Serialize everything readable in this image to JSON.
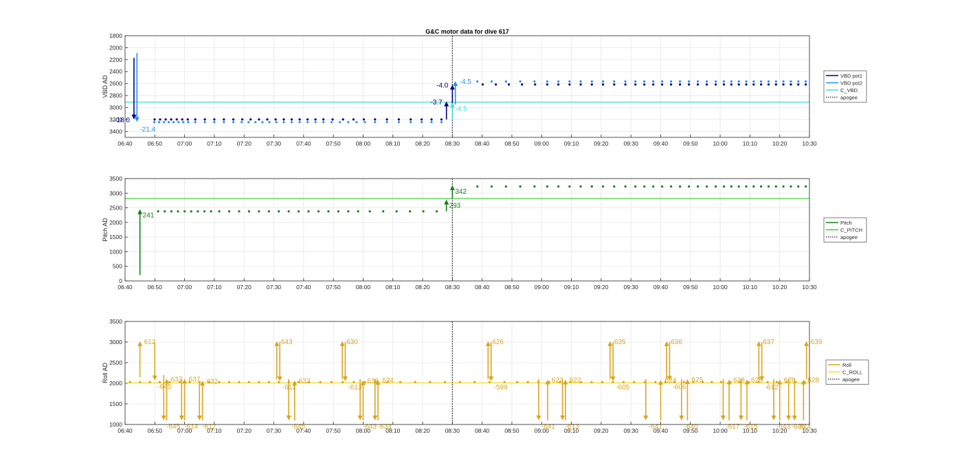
{
  "chart_data": {
    "title": "G&C motor data for dive 617",
    "time_ticks": [
      "06:40",
      "06:50",
      "07:00",
      "07:10",
      "07:20",
      "07:30",
      "07:40",
      "07:50",
      "08:00",
      "08:10",
      "08:20",
      "08:30",
      "08:40",
      "08:50",
      "09:00",
      "09:10",
      "09:20",
      "09:30",
      "09:40",
      "09:50",
      "10:00",
      "10:10",
      "10:20",
      "10:30"
    ],
    "apogee_time": "08:30",
    "panels": [
      {
        "type": "scatter",
        "ylabel": "VBD AD",
        "ylim": [
          1800,
          3500
        ],
        "y_reversed": true,
        "yticks": [
          1800,
          2000,
          2200,
          2400,
          2600,
          2800,
          3000,
          3200,
          3400
        ],
        "hlines": [
          {
            "series": "C_VBD",
            "y": 2910
          }
        ],
        "legend": [
          {
            "label": "VBD pot1",
            "color": "#000080",
            "style": "solid"
          },
          {
            "label": "VBD pot2",
            "color": "#1e90ff",
            "style": "solid"
          },
          {
            "label": "C_VBD",
            "color": "#40e0d0",
            "style": "solid"
          },
          {
            "label": "apogee",
            "color": "#444444",
            "style": "dotted"
          }
        ],
        "point_sets": [
          {
            "series": "VBD pot1",
            "color": "#000080",
            "y": 3200,
            "x_min": [
              "06:49",
              "07:02",
              "07:18",
              "07:32",
              "07:48",
              "08:02",
              "08:18"
            ],
            "x_max": [
              "07:02",
              "07:18",
              "07:32",
              "07:48",
              "08:02",
              "08:18",
              "08:28"
            ],
            "count": [
              7,
              5,
              5,
              6,
              4,
              4,
              3
            ]
          },
          {
            "series": "VBD pot2",
            "color": "#1e90ff",
            "y": 3245,
            "x_min": [
              "06:49",
              "07:02",
              "07:18",
              "07:32",
              "07:48",
              "08:02",
              "08:18"
            ],
            "x_max": [
              "07:02",
              "07:18",
              "07:32",
              "07:48",
              "08:02",
              "08:18",
              "08:28"
            ],
            "count": [
              8,
              5,
              6,
              6,
              5,
              4,
              3
            ]
          },
          {
            "series": "VBD pot1",
            "color": "#000080",
            "y": 2615,
            "x_min": [
              "08:38",
              "09:00",
              "09:30",
              "10:00"
            ],
            "x_max": [
              "09:00",
              "09:30",
              "10:00",
              "10:30"
            ],
            "count": [
              5,
              8,
              10,
              12
            ]
          },
          {
            "series": "VBD pot2",
            "color": "#1e90ff",
            "y": 2565,
            "x_min": [
              "08:36",
              "09:00",
              "09:30",
              "10:00"
            ],
            "x_max": [
              "09:00",
              "09:30",
              "10:00",
              "10:30"
            ],
            "count": [
              5,
              8,
              10,
              12
            ]
          }
        ],
        "arrows": [
          {
            "x": "06:43",
            "y_from": 2170,
            "y_to": 3200,
            "color": "#000080",
            "label": "-18.0",
            "label_side": "left"
          },
          {
            "x": "06:44",
            "y_from": 2090,
            "y_to": 3240,
            "color": "#1e90ff",
            "label": "-21.4",
            "label_side": "below"
          },
          {
            "x": "08:28",
            "y_from": 3200,
            "y_to": 2900,
            "color": "#000080",
            "label": "-3.7",
            "label_side": "left"
          },
          {
            "x": "08:30",
            "y_from": 2960,
            "y_to": 2620,
            "color": "#000080",
            "label": "-4.0",
            "label_side": "left"
          },
          {
            "x": "08:31",
            "y_from": 2950,
            "y_to": 2560,
            "color": "#1e90ff",
            "label": "-4.5",
            "label_side": "right"
          },
          {
            "x": "08:30",
            "y_from": 3200,
            "y_to": 2920,
            "color": "#40e0d0",
            "label": "-4.5",
            "label_side": "below-right"
          }
        ]
      },
      {
        "type": "scatter",
        "ylabel": "Pitch AD",
        "ylim": [
          0,
          3500
        ],
        "y_reversed": false,
        "yticks": [
          0,
          500,
          1000,
          1500,
          2000,
          2500,
          3000,
          3500
        ],
        "hlines": [
          {
            "series": "C_PITCH",
            "y": 2820
          }
        ],
        "legend": [
          {
            "label": "Pitch",
            "color": "#137f13",
            "style": "solid"
          },
          {
            "label": "C_PITCH",
            "color": "#32cd32",
            "style": "solid"
          },
          {
            "label": "apogee",
            "color": "#444444",
            "style": "dotted"
          }
        ],
        "point_sets": [
          {
            "series": "Pitch",
            "color": "#137f13",
            "y": 2380,
            "x_min": [
              "06:50",
              "07:10",
              "07:40",
              "08:00"
            ],
            "x_max": [
              "07:10",
              "07:40",
              "08:00",
              "08:27"
            ],
            "count": [
              9,
              9,
              6,
              6
            ]
          },
          {
            "series": "Pitch",
            "color": "#137f13",
            "y": 3230,
            "x_min": [
              "08:36",
              "09:00",
              "09:30",
              "10:00"
            ],
            "x_max": [
              "09:00",
              "09:30",
              "10:00",
              "10:30"
            ],
            "count": [
              5,
              8,
              10,
              12
            ]
          }
        ],
        "arrows": [
          {
            "x": "06:45",
            "y_from": 200,
            "y_to": 2450,
            "color": "#137f13",
            "label": "241",
            "label_side": "below-right"
          },
          {
            "x": "08:28",
            "y_from": 2380,
            "y_to": 2780,
            "color": "#137f13",
            "label": "293",
            "label_side": "below-right"
          },
          {
            "x": "08:30",
            "y_from": 2850,
            "y_to": 3270,
            "color": "#137f13",
            "label": "342",
            "label_side": "below-right"
          }
        ]
      },
      {
        "type": "scatter",
        "ylabel": "Roll AD",
        "ylim": [
          1000,
          3500
        ],
        "y_reversed": false,
        "yticks": [
          1000,
          1500,
          2000,
          2500,
          3000,
          3500
        ],
        "hlines": [
          {
            "series": "C_ROLL",
            "y": 2010
          }
        ],
        "legend": [
          {
            "label": "Roll",
            "color": "#daa520",
            "style": "solid"
          },
          {
            "label": "C_ROLL",
            "color": "#f0e030",
            "style": "solid"
          },
          {
            "label": "apogee",
            "color": "#444444",
            "style": "dotted"
          }
        ],
        "point_sets": [
          {
            "series": "Roll",
            "color": "#daa520",
            "y": 2030,
            "x_min": [
              "06:40",
              "07:00",
              "07:40",
              "08:10",
              "08:50",
              "09:40"
            ],
            "x_max": [
              "07:00",
              "07:40",
              "08:10",
              "08:50",
              "09:40",
              "10:30"
            ],
            "count": [
              6,
              12,
              8,
              8,
              14,
              16
            ]
          }
        ],
        "arrows": [
          {
            "x": "06:45",
            "y_from": 2150,
            "y_to": 3020,
            "color": "#daa520",
            "label": "612",
            "label_side": "right"
          },
          {
            "x": "06:50",
            "y_from": 3000,
            "y_to": 2070,
            "color": "#daa520",
            "label": "-645",
            "label_side": "below-right"
          },
          {
            "x": "06:53",
            "y_from": 2200,
            "y_to": 1100,
            "color": "#daa520",
            "label": "-645",
            "label_side": "below-right"
          },
          {
            "x": "06:54",
            "y_from": 1100,
            "y_to": 2110,
            "color": "#daa520",
            "label": "637",
            "label_side": "right"
          },
          {
            "x": "06:59",
            "y_from": 2100,
            "y_to": 1100,
            "color": "#daa520",
            "label": "-614",
            "label_side": "below-right"
          },
          {
            "x": "07:00",
            "y_from": 1100,
            "y_to": 2110,
            "color": "#daa520",
            "label": "637",
            "label_side": "right"
          },
          {
            "x": "07:06",
            "y_from": 1100,
            "y_to": 2060,
            "color": "#daa520",
            "label": "632",
            "label_side": "right"
          },
          {
            "x": "07:05",
            "y_from": 2000,
            "y_to": 1100,
            "color": "#daa520",
            "label": "-612",
            "label_side": "below-right"
          },
          {
            "x": "07:31",
            "y_from": 2100,
            "y_to": 3020,
            "color": "#daa520",
            "label": "643",
            "label_side": "right"
          },
          {
            "x": "07:32",
            "y_from": 3000,
            "y_to": 2050,
            "color": "#daa520",
            "label": "-611",
            "label_side": "below-right"
          },
          {
            "x": "07:35",
            "y_from": 2100,
            "y_to": 1100,
            "color": "#daa520",
            "label": "-645",
            "label_side": "below-right"
          },
          {
            "x": "07:37",
            "y_from": 1100,
            "y_to": 2070,
            "color": "#daa520",
            "label": "632",
            "label_side": "right"
          },
          {
            "x": "07:53",
            "y_from": 2100,
            "y_to": 3020,
            "color": "#daa520",
            "label": "630",
            "label_side": "right"
          },
          {
            "x": "07:54",
            "y_from": 3000,
            "y_to": 2050,
            "color": "#daa520",
            "label": "-613",
            "label_side": "below-right"
          },
          {
            "x": "07:59",
            "y_from": 2100,
            "y_to": 1100,
            "color": "#daa520",
            "label": "-643",
            "label_side": "below-right"
          },
          {
            "x": "08:00",
            "y_from": 1100,
            "y_to": 2070,
            "color": "#daa520",
            "label": "633",
            "label_side": "right"
          },
          {
            "x": "08:04",
            "y_from": 2100,
            "y_to": 1100,
            "color": "#daa520",
            "label": "-633",
            "label_side": "below-right"
          },
          {
            "x": "08:05",
            "y_from": 1100,
            "y_to": 2080,
            "color": "#daa520",
            "label": "634",
            "label_side": "right"
          },
          {
            "x": "08:42",
            "y_from": 2100,
            "y_to": 3020,
            "color": "#daa520",
            "label": "626",
            "label_side": "right"
          },
          {
            "x": "08:43",
            "y_from": 3000,
            "y_to": 2050,
            "color": "#daa520",
            "label": "-599",
            "label_side": "below-right"
          },
          {
            "x": "08:59",
            "y_from": 2100,
            "y_to": 1100,
            "color": "#daa520",
            "label": "-641",
            "label_side": "below-right"
          },
          {
            "x": "09:02",
            "y_from": 1100,
            "y_to": 2090,
            "color": "#daa520",
            "label": "622",
            "label_side": "right"
          },
          {
            "x": "09:07",
            "y_from": 2100,
            "y_to": 1100,
            "color": "#daa520",
            "label": "-613",
            "label_side": "below-right"
          },
          {
            "x": "09:08",
            "y_from": 1100,
            "y_to": 2090,
            "color": "#daa520",
            "label": "622",
            "label_side": "right"
          },
          {
            "x": "09:23",
            "y_from": 2100,
            "y_to": 3020,
            "color": "#daa520",
            "label": "635",
            "label_side": "right"
          },
          {
            "x": "09:24",
            "y_from": 3000,
            "y_to": 2050,
            "color": "#daa520",
            "label": "-605",
            "label_side": "below-right"
          },
          {
            "x": "09:35",
            "y_from": 2100,
            "y_to": 1100,
            "color": "#daa520",
            "label": "-641",
            "label_side": "below-right"
          },
          {
            "x": "09:40",
            "y_from": 1100,
            "y_to": 2080,
            "color": "#daa520",
            "label": "624",
            "label_side": "right"
          },
          {
            "x": "09:42",
            "y_from": 2100,
            "y_to": 3020,
            "color": "#daa520",
            "label": "636",
            "label_side": "right"
          },
          {
            "x": "09:43",
            "y_from": 3000,
            "y_to": 2060,
            "color": "#daa520",
            "label": "-606",
            "label_side": "below-right"
          },
          {
            "x": "09:47",
            "y_from": 2100,
            "y_to": 1100,
            "color": "#daa520",
            "label": "-640",
            "label_side": "below-right"
          },
          {
            "x": "09:49",
            "y_from": 1100,
            "y_to": 2100,
            "color": "#daa520",
            "label": "625",
            "label_side": "right"
          },
          {
            "x": "10:01",
            "y_from": 2100,
            "y_to": 1100,
            "color": "#daa520",
            "label": "-617",
            "label_side": "below-right"
          },
          {
            "x": "10:03",
            "y_from": 1100,
            "y_to": 2090,
            "color": "#daa520",
            "label": "628",
            "label_side": "right"
          },
          {
            "x": "10:07",
            "y_from": 2100,
            "y_to": 1100,
            "color": "#daa520",
            "label": "-615",
            "label_side": "below-right"
          },
          {
            "x": "10:09",
            "y_from": 1100,
            "y_to": 2090,
            "color": "#daa520",
            "label": "626",
            "label_side": "right"
          },
          {
            "x": "10:13",
            "y_from": 2100,
            "y_to": 3020,
            "color": "#daa520",
            "label": "637",
            "label_side": "right"
          },
          {
            "x": "10:14",
            "y_from": 3000,
            "y_to": 2050,
            "color": "#daa520",
            "label": "-612",
            "label_side": "below-right"
          },
          {
            "x": "10:18",
            "y_from": 2100,
            "y_to": 1100,
            "color": "#daa520",
            "label": "-643",
            "label_side": "below-right"
          },
          {
            "x": "10:20",
            "y_from": 1100,
            "y_to": 2090,
            "color": "#daa520",
            "label": "628",
            "label_side": "right"
          },
          {
            "x": "10:23",
            "y_from": 2100,
            "y_to": 1100,
            "color": "#daa520",
            "label": "-636",
            "label_side": "below-right"
          },
          {
            "x": "10:25",
            "y_from": 2100,
            "y_to": 1100,
            "color": "#daa520",
            "label": "-614",
            "label_side": "below-right"
          },
          {
            "x": "10:28",
            "y_from": 1100,
            "y_to": 2090,
            "color": "#daa520",
            "label": "628",
            "label_side": "right"
          },
          {
            "x": "10:29",
            "y_from": 2100,
            "y_to": 3020,
            "color": "#daa520",
            "label": "639",
            "label_side": "right"
          }
        ]
      }
    ]
  }
}
